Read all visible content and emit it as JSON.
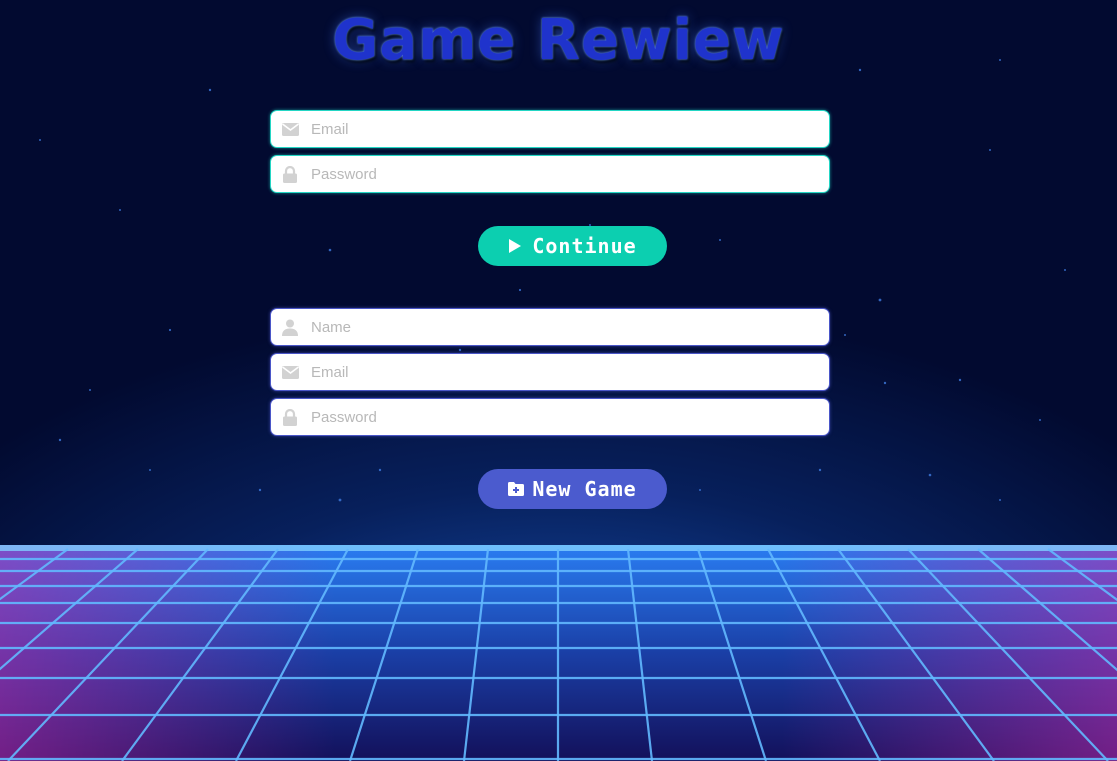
{
  "title": "Game Rewiew",
  "login": {
    "email_placeholder": "Email",
    "password_placeholder": "Password",
    "email_icon": "envelope-icon",
    "password_icon": "lock-icon"
  },
  "continue_button": {
    "label": "Continue",
    "icon": "play-icon",
    "color": "#0ccfb0"
  },
  "signup": {
    "name_placeholder": "Name",
    "email_placeholder": "Email",
    "password_placeholder": "Password",
    "name_icon": "user-icon",
    "email_icon": "envelope-icon",
    "password_icon": "lock-icon"
  },
  "new_game_button": {
    "label": "New Game",
    "icon": "folder-plus-icon",
    "color": "#4b5bce"
  },
  "colors": {
    "title": "#1f33cc",
    "login_border": "#23d6c4",
    "signup_border": "#4a56c8",
    "grid_line": "#5cb4ff"
  }
}
